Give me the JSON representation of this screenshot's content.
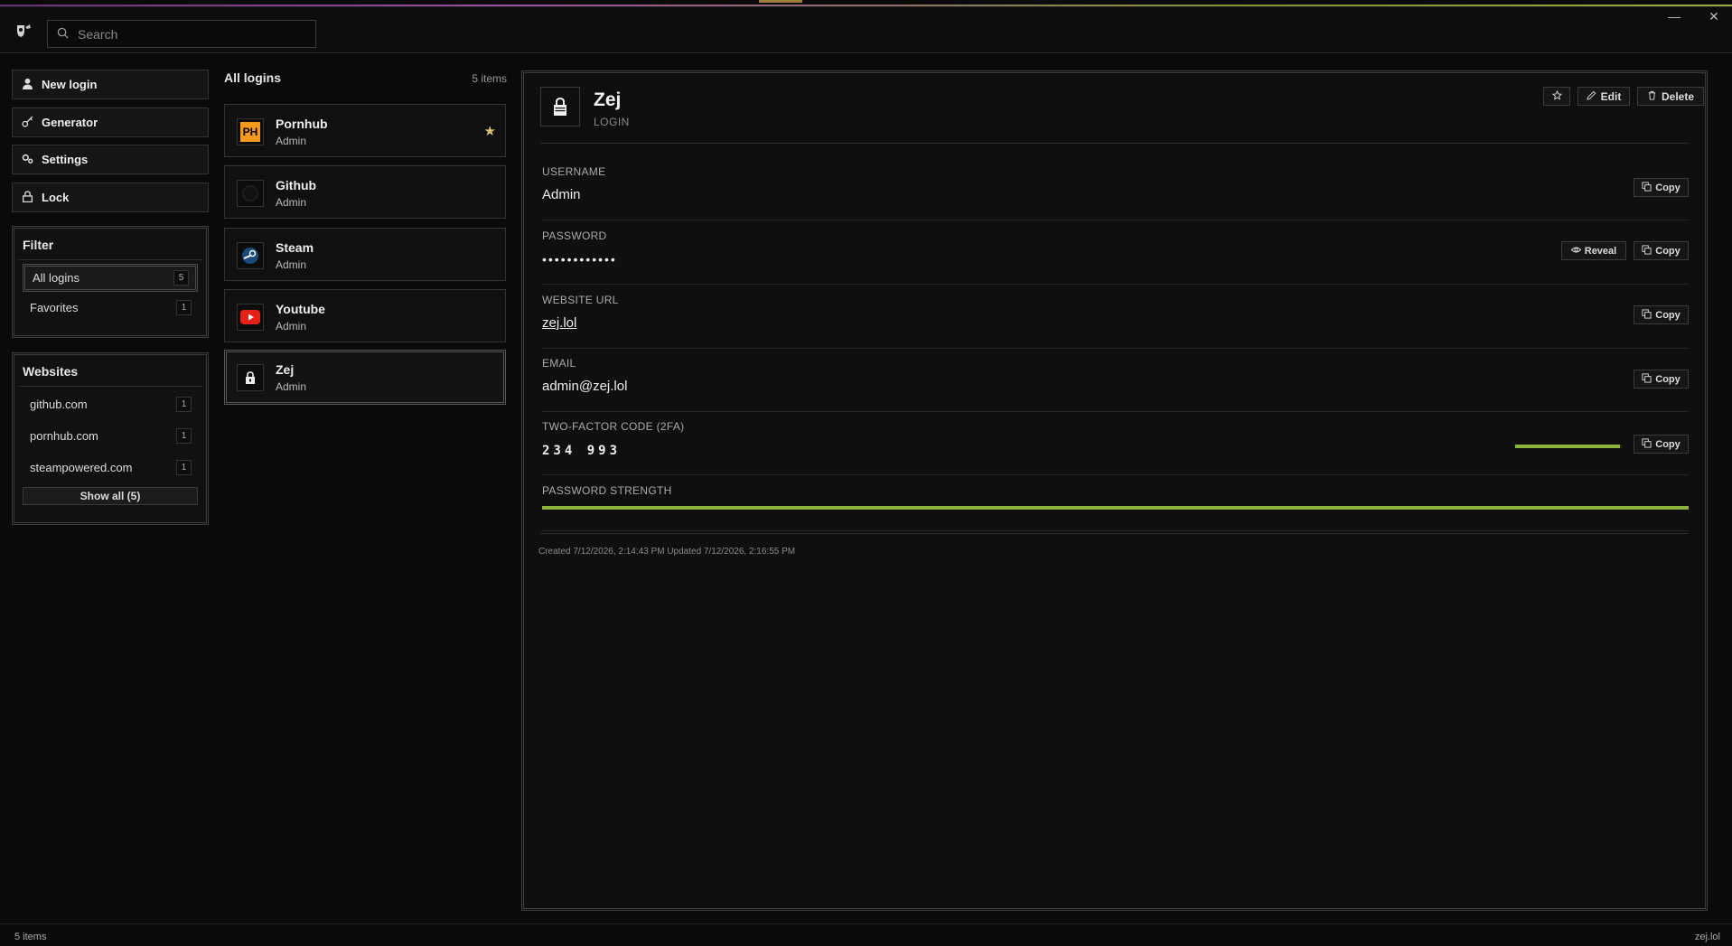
{
  "titlebar": {
    "search_placeholder": "Search",
    "minimize": "—",
    "close": "✕"
  },
  "sidebar": {
    "buttons": [
      {
        "label": "New login",
        "icon": "user-icon"
      },
      {
        "label": "Generator",
        "icon": "key-icon"
      },
      {
        "label": "Settings",
        "icon": "gears-icon"
      },
      {
        "label": "Lock",
        "icon": "lock-icon"
      }
    ],
    "filter": {
      "title": "Filter",
      "items": [
        {
          "label": "All logins",
          "count": "5"
        },
        {
          "label": "Favorites",
          "count": "1"
        }
      ]
    },
    "websites": {
      "title": "Websites",
      "items": [
        {
          "label": "github.com",
          "count": "1"
        },
        {
          "label": "pornhub.com",
          "count": "1"
        },
        {
          "label": "steampowered.com",
          "count": "1"
        }
      ],
      "show_all": "Show all (5)"
    }
  },
  "list": {
    "title": "All logins",
    "count": "5 items",
    "items": [
      {
        "name": "Pornhub",
        "sub": "Admin",
        "icon": "pornhub-icon",
        "icon_text": "PH",
        "favorite": true
      },
      {
        "name": "Github",
        "sub": "Admin",
        "icon": "github-icon"
      },
      {
        "name": "Steam",
        "sub": "Admin",
        "icon": "steam-icon"
      },
      {
        "name": "Youtube",
        "sub": "Admin",
        "icon": "youtube-icon"
      },
      {
        "name": "Zej",
        "sub": "Admin",
        "icon": "lock-icon"
      }
    ]
  },
  "detail": {
    "title": "Zej",
    "type": "LOGIN",
    "actions": {
      "edit": "Edit",
      "delete": "Delete"
    },
    "fields": [
      {
        "label": "USERNAME",
        "value": "Admin"
      },
      {
        "label": "PASSWORD",
        "value": "••••••••••••"
      },
      {
        "label": "WEBSITE URL",
        "value": "zej.lol"
      },
      {
        "label": "EMAIL",
        "value": "admin@zej.lol"
      },
      {
        "label": "TWO-FACTOR CODE (2FA)",
        "value": "234 993"
      },
      {
        "label": "PASSWORD STRENGTH",
        "value": ""
      }
    ],
    "copy_label": "Copy",
    "reveal_label": "Reveal",
    "totp_remaining_fraction": 0.98,
    "password_strength_fraction": 1.0,
    "meta": "Created 7/12/2026, 2:14:43 PM Updated 7/12/2026, 2:16:55 PM"
  },
  "statusbar": {
    "left": "5 items",
    "right": "zej.lol"
  },
  "colors": {
    "accent_green": "#8fb23a",
    "star": "#d8c27a",
    "background": "#0a0a0a"
  }
}
